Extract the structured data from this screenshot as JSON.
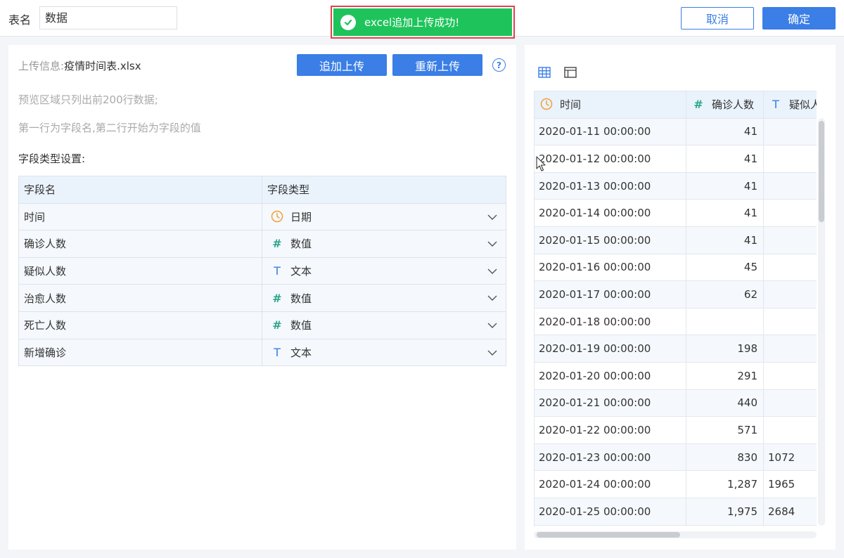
{
  "header": {
    "table_name_label": "表名",
    "table_name_value": "数据",
    "cancel_label": "取消",
    "confirm_label": "确定"
  },
  "toast": {
    "message": "excel追加上传成功!",
    "color": "#1ec45b"
  },
  "upload": {
    "info_label": "上传信息:",
    "file_name": "疫情时间表.xlsx",
    "append_label": "追加上传",
    "reupload_label": "重新上传",
    "help_icon": "question-circle-icon"
  },
  "notes": {
    "preview": "预览区域只列出前200行数据;",
    "row_rule": "第一行为字段名,第二行开始为字段的值"
  },
  "field_settings": {
    "title": "字段类型设置:",
    "headers": {
      "name": "字段名",
      "type": "字段类型"
    },
    "rows": [
      {
        "name": "时间",
        "type": "日期",
        "icon": "clock-icon"
      },
      {
        "name": "确诊人数",
        "type": "数值",
        "icon": "hash-icon"
      },
      {
        "name": "疑似人数",
        "type": "文本",
        "icon": "text-t-icon"
      },
      {
        "name": "治愈人数",
        "type": "数值",
        "icon": "hash-icon"
      },
      {
        "name": "死亡人数",
        "type": "数值",
        "icon": "hash-icon"
      },
      {
        "name": "新增确诊",
        "type": "文本",
        "icon": "text-t-icon"
      }
    ]
  },
  "preview": {
    "view_icons": [
      "grid-view-icon",
      "layout-view-icon"
    ],
    "headers": [
      {
        "label": "时间",
        "icon": "clock-icon"
      },
      {
        "label": "确诊人数",
        "icon": "hash-icon"
      },
      {
        "label": "疑似人",
        "icon": "text-t-icon"
      }
    ],
    "rows": [
      {
        "time": "2020-01-11 00:00:00",
        "confirmed": "41",
        "suspected": ""
      },
      {
        "time": "2020-01-12 00:00:00",
        "confirmed": "41",
        "suspected": ""
      },
      {
        "time": "2020-01-13 00:00:00",
        "confirmed": "41",
        "suspected": ""
      },
      {
        "time": "2020-01-14 00:00:00",
        "confirmed": "41",
        "suspected": ""
      },
      {
        "time": "2020-01-15 00:00:00",
        "confirmed": "41",
        "suspected": ""
      },
      {
        "time": "2020-01-16 00:00:00",
        "confirmed": "45",
        "suspected": ""
      },
      {
        "time": "2020-01-17 00:00:00",
        "confirmed": "62",
        "suspected": ""
      },
      {
        "time": "2020-01-18 00:00:00",
        "confirmed": "",
        "suspected": ""
      },
      {
        "time": "2020-01-19 00:00:00",
        "confirmed": "198",
        "suspected": ""
      },
      {
        "time": "2020-01-20 00:00:00",
        "confirmed": "291",
        "suspected": ""
      },
      {
        "time": "2020-01-21 00:00:00",
        "confirmed": "440",
        "suspected": ""
      },
      {
        "time": "2020-01-22 00:00:00",
        "confirmed": "571",
        "suspected": ""
      },
      {
        "time": "2020-01-23 00:00:00",
        "confirmed": "830",
        "suspected": "1072"
      },
      {
        "time": "2020-01-24 00:00:00",
        "confirmed": "1,287",
        "suspected": "1965"
      },
      {
        "time": "2020-01-25 00:00:00",
        "confirmed": "1,975",
        "suspected": "2684"
      }
    ]
  },
  "colors": {
    "primary": "#3a7ee6",
    "alert_border": "#e0434b",
    "date_icon": "#f0a13c",
    "number_icon": "#2aa58c"
  }
}
